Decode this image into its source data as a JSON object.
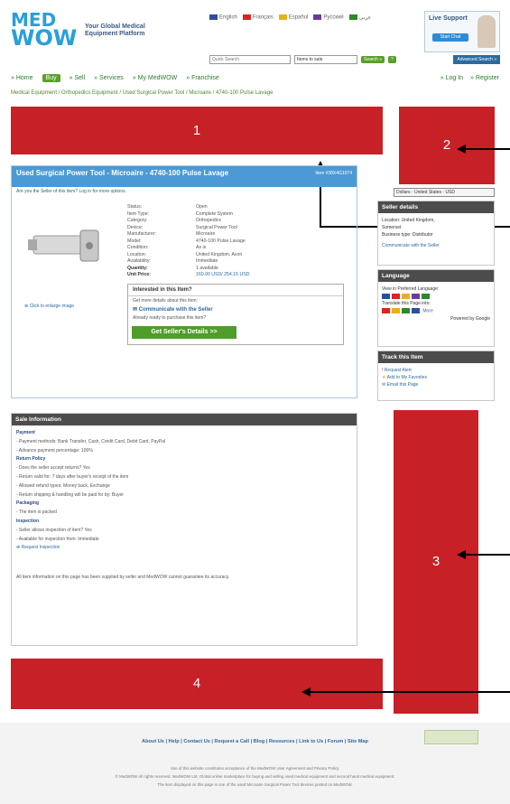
{
  "header": {
    "logo_top": "MED",
    "logo_bottom": "WOW",
    "tagline_1": "Your Global Medical",
    "tagline_2": "Equipment Platform",
    "languages": [
      "English",
      "Français",
      "Español",
      "Pусский",
      "عربي"
    ],
    "live_support": "Live Support",
    "start_chat": "Start Chat",
    "search_placeholder": "Quick Search",
    "search_filter": "Items to sale",
    "search_button": "Search »",
    "advanced_search": "Advanced Search »"
  },
  "nav": {
    "items": [
      "Home",
      "Buy",
      "Sell",
      "Services",
      "My MedWOW",
      "Franchise"
    ],
    "login": "Log In",
    "register": "Register"
  },
  "breadcrumb": "Medical Equipment / Orthopedics Equipment / Used Surgical Power Tool / Microaire / 4740-100 Pulse Lavage",
  "callouts": {
    "c1": "1",
    "c2": "2",
    "c3": "3",
    "c4": "4"
  },
  "product": {
    "title": "Used Surgical Power Tool - Microaire - 4740-100 Pulse Lavage",
    "item_number": "Item #38X4G1074",
    "seller_prompt": "Are you the Seller of this item? Log in for more options.",
    "enlarge": "Click to enlarge image",
    "specs": [
      {
        "k": "Status:",
        "v": "Open"
      },
      {
        "k": "Item Type:",
        "v": "Complete System"
      },
      {
        "k": "Category:",
        "v": "Orthopedics"
      },
      {
        "k": "Device:",
        "v": "Surgical Power Tool"
      },
      {
        "k": "Manufacturer:",
        "v": "Microaire"
      },
      {
        "k": "Model:",
        "v": "4740-100 Pulse Lavage"
      },
      {
        "k": "Condition:",
        "v": "As is"
      },
      {
        "k": "Location:",
        "v": "United Kingdom, Avon"
      },
      {
        "k": "Availability:",
        "v": "Immediate"
      },
      {
        "k": "Quantity:",
        "v": "1 available"
      },
      {
        "k": "Unit Price:",
        "v": "160.00 USD/ 254.15 USD"
      }
    ],
    "interest_title": "Interested in this Item?",
    "interest_text": "Get more details about this item:",
    "communicate": "Communicate with the Seller",
    "ready_text": "Already ready to purchase this item?",
    "get_details": "Get Seller's Details >>"
  },
  "sidebar": {
    "currency": "Dollars - United States - USD",
    "seller_details": "Seller details",
    "seller_location": "Location: United Kingdom,",
    "seller_location_2": "Somerset",
    "seller_business": "Business type: Distributor",
    "seller_communicate": "Communicate with the Seller",
    "language_title": "Language",
    "view_in": "View in Preferred Language:",
    "translate_label": "Translate this Page into:",
    "translate_more": "More",
    "powered": "Powered by Google",
    "track_title": "Track this Item",
    "track_items": [
      "Request Alert",
      "Add to My Favorites",
      "Email this Page"
    ]
  },
  "sale": {
    "title": "Sale Information",
    "lines": [
      {
        "t": "Payment",
        "b": true
      },
      {
        "t": "- Payment methods: Bank Transfer, Cash, Credit Card, Debit Card, PayPal",
        "b": false
      },
      {
        "t": "- Advance payment percentage: 100%",
        "b": false
      },
      {
        "t": "Return Policy",
        "b": true
      },
      {
        "t": "- Does the seller accept returns? Yes",
        "b": false
      },
      {
        "t": "- Return valid for: 7 days after buyer's receipt of the item",
        "b": false
      },
      {
        "t": "- Allowed refund types: Money back, Exchange",
        "b": false
      },
      {
        "t": "- Return shipping & handling will be paid for by: Buyer",
        "b": false
      },
      {
        "t": "Packaging",
        "b": true
      },
      {
        "t": "- The item is packed",
        "b": false
      },
      {
        "t": "Inspection",
        "b": true
      },
      {
        "t": "- Seller allows inspection of item? Yes",
        "b": false
      },
      {
        "t": "- Available for inspection from: Immediate",
        "b": false
      },
      {
        "t": "Request Inspection",
        "b": false
      }
    ],
    "disclaimer": "All item information on this page has been supplied by seller and MedWOW cannot guarantee its accuracy."
  },
  "footer": {
    "links": "About Us | Help | Contact Us | Request a Call | Blog | Resources | Link to Us | Forum | Site Map",
    "small_1": "Use of this website constitutes acceptance of the MedWOW User Agreement and Privacy Policy.",
    "small_2": "© MedWOW All rights reserved. MedWOW Ltd. Global online marketplace for buying and selling used medical equipment and second hand medical equipment.",
    "small_3": "The item displayed on this page is one of the used Microaire Surgical Power Tool devices posted on MedWOW."
  },
  "colors": {
    "callout_red": "#c82027",
    "nav_green": "#5aa02c",
    "title_blue": "#4b9ad6",
    "panel_dark": "#4c4c4c"
  }
}
